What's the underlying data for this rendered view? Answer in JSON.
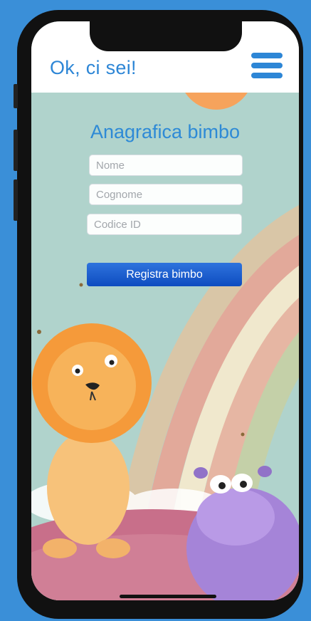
{
  "header": {
    "title": "Ok, ci sei!",
    "menu_icon": "hamburger-menu-icon"
  },
  "form": {
    "title": "Anagrafica bimbo",
    "fields": [
      {
        "placeholder": "Nome",
        "value": ""
      },
      {
        "placeholder": "Cognome",
        "value": ""
      },
      {
        "placeholder": "Codice ID",
        "value": ""
      }
    ],
    "submit_label": "Registra bimbo"
  },
  "colors": {
    "accent": "#2d86d6",
    "button": "#1a5fd0",
    "background": "#a9cfc9"
  },
  "illustration": {
    "elements": [
      "sun",
      "rainbow",
      "lion",
      "hippo",
      "flying-bugs"
    ]
  }
}
